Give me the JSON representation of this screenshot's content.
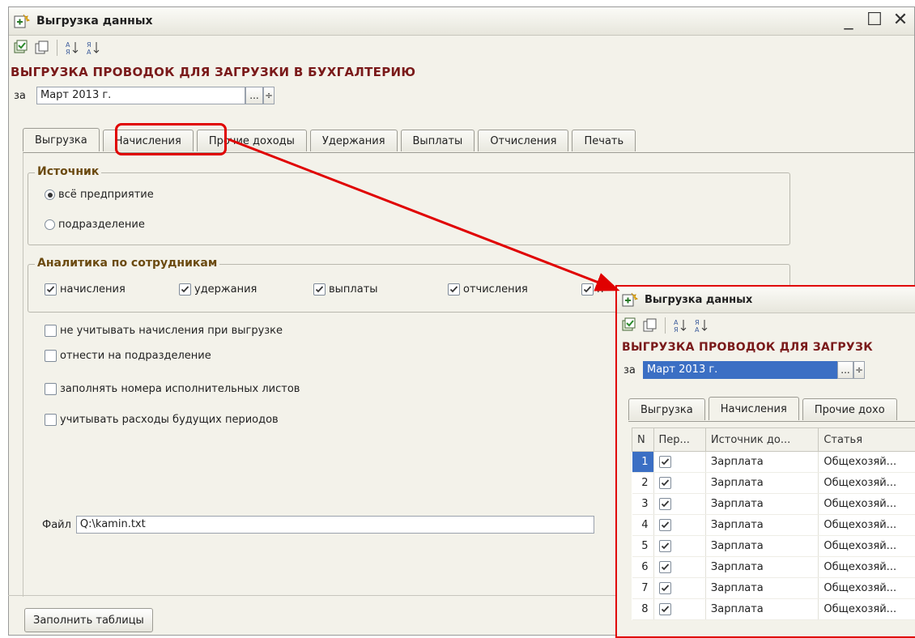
{
  "window": {
    "title": "Выгрузка данных",
    "controls": [
      "_",
      "☐",
      "✕"
    ]
  },
  "toolbar": {
    "icons": [
      "form-check-icon",
      "copy-icon",
      "sort-ascending-icon",
      "sort-descending-icon"
    ]
  },
  "heading": "ВЫГРУЗКА ПРОВОДОК ДЛЯ ЗАГРУЗКИ В БУХГАЛТЕРИЮ",
  "period": {
    "label": "за",
    "value": "Март 2013 г.",
    "select_label": "...",
    "spin_label": "÷"
  },
  "tabs": [
    {
      "label": "Выгрузка",
      "active": true
    },
    {
      "label": "Начисления",
      "active": false
    },
    {
      "label": "Прочие доходы",
      "active": false
    },
    {
      "label": "Удержания",
      "active": false
    },
    {
      "label": "Выплаты",
      "active": false
    },
    {
      "label": "Отчисления",
      "active": false
    },
    {
      "label": "Печать",
      "active": false
    }
  ],
  "source_group": {
    "title": "Источник",
    "options": [
      {
        "label": "всё предприятие",
        "selected": true
      },
      {
        "label": "подразделение",
        "selected": false
      }
    ]
  },
  "analytics_group": {
    "title": "Аналитика по сотрудникам",
    "options": [
      {
        "label": "начисления",
        "checked": true
      },
      {
        "label": "удержания",
        "checked": true
      },
      {
        "label": "выплаты",
        "checked": true
      },
      {
        "label": "отчисления",
        "checked": true
      },
      {
        "label": "п",
        "checked": true
      }
    ]
  },
  "options": [
    {
      "label": "не учитывать начисления при выгрузке",
      "checked": false
    },
    {
      "label": "отнести на подразделение",
      "checked": false
    },
    {
      "label": "заполнять номера исполнительных листов",
      "checked": false
    },
    {
      "label": "учитывать расходы будущих периодов",
      "checked": false
    }
  ],
  "file": {
    "label": "Файл",
    "value": "Q:\\kamin.txt"
  },
  "fill_button": "Заполнить таблицы",
  "inset": {
    "title": "Выгрузка данных",
    "heading": "ВЫГРУЗКА ПРОВОДОК ДЛЯ ЗАГРУЗК",
    "period_label": "за",
    "period_value": "Март 2013 г.",
    "tabs": [
      {
        "label": "Выгрузка",
        "active": false
      },
      {
        "label": "Начисления",
        "active": true
      },
      {
        "label": "Прочие дохо",
        "active": false
      }
    ],
    "table": {
      "columns": [
        "N",
        "Пер...",
        "Источник до...",
        "Статья"
      ],
      "rows": [
        {
          "n": "1",
          "checked": true,
          "source": "Зарплата",
          "article": "Общехозяй..."
        },
        {
          "n": "2",
          "checked": true,
          "source": "Зарплата",
          "article": "Общехозяй..."
        },
        {
          "n": "3",
          "checked": true,
          "source": "Зарплата",
          "article": "Общехозяй..."
        },
        {
          "n": "4",
          "checked": true,
          "source": "Зарплата",
          "article": "Общехозяй..."
        },
        {
          "n": "5",
          "checked": true,
          "source": "Зарплата",
          "article": "Общехозяй..."
        },
        {
          "n": "6",
          "checked": true,
          "source": "Зарплата",
          "article": "Общехозяй..."
        },
        {
          "n": "7",
          "checked": true,
          "source": "Зарплата",
          "article": "Общехозяй..."
        },
        {
          "n": "8",
          "checked": true,
          "source": "Зарплата",
          "article": "Общехозяй..."
        }
      ],
      "selected_row": 0
    }
  },
  "colors": {
    "heading": "#7a1a1a",
    "group_title": "#6b4a10",
    "highlight": "#e00000",
    "selection": "#3b6fc4"
  }
}
